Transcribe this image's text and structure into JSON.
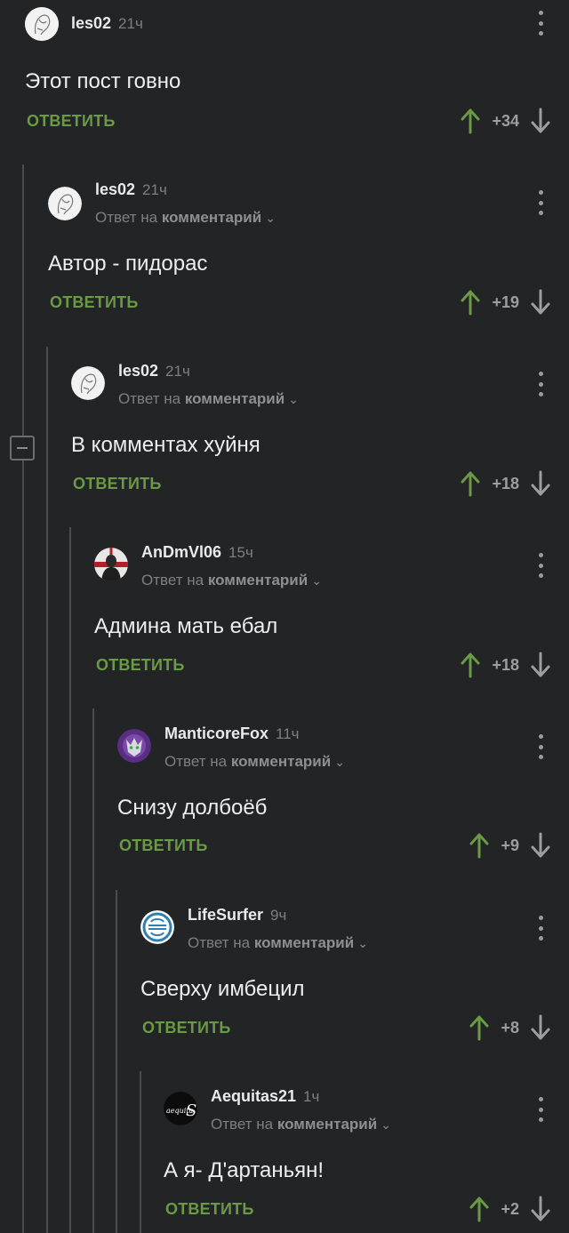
{
  "reply_label": "ОТВЕТИТЬ",
  "reply_prefix": "Ответ на",
  "reply_target": "комментарий",
  "colors": {
    "background": "#222426",
    "reply": "#6a9a45",
    "upvote": "#6a9a45"
  },
  "comments": [
    {
      "username": "les02",
      "time": "21ч",
      "text": "Этот пост говно",
      "score": "+34",
      "avatar": "sketch-avatar"
    },
    {
      "username": "les02",
      "time": "21ч",
      "text": "Автор - пидорас",
      "score": "+19",
      "avatar": "sketch-avatar"
    },
    {
      "username": "les02",
      "time": "21ч",
      "text": "В комментах хуйня",
      "score": "+18",
      "avatar": "sketch-avatar"
    },
    {
      "username": "AnDmVl06",
      "time": "15ч",
      "text": "Админа мать ебал",
      "score": "+18",
      "avatar": "figure-avatar"
    },
    {
      "username": "ManticoreFox",
      "time": "11ч",
      "text": "Снизу долбоёб",
      "score": "+9",
      "avatar": "fox-avatar"
    },
    {
      "username": "LifeSurfer",
      "time": "9ч",
      "text": "Сверху имбецил",
      "score": "+8",
      "avatar": "emblem-avatar"
    },
    {
      "username": "Aequitas21",
      "time": "1ч",
      "text": "А я- Д'артаньян!",
      "score": "+2",
      "avatar": "logo-avatar",
      "avatar_text": "aequitaS"
    }
  ]
}
